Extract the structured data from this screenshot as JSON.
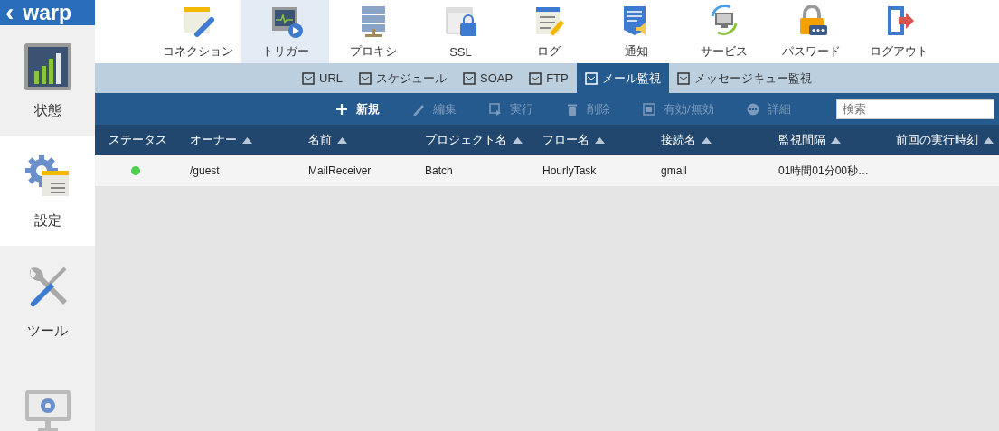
{
  "app": {
    "back_icon_glyph": "‹",
    "title": "warp"
  },
  "sidebar": {
    "items": [
      {
        "label": "状態",
        "selected": false
      },
      {
        "label": "設定",
        "selected": true
      },
      {
        "label": "ツール",
        "selected": false
      },
      {
        "selected": false
      }
    ]
  },
  "top_nav": {
    "items": [
      {
        "label": "コネクション",
        "selected": false
      },
      {
        "label": "トリガー",
        "selected": true
      },
      {
        "label": "プロキシ",
        "selected": false
      },
      {
        "label": "SSL",
        "selected": false
      },
      {
        "label": "ログ",
        "selected": false
      },
      {
        "label": "通知",
        "selected": false
      },
      {
        "label": "サービス",
        "selected": false
      },
      {
        "label": "パスワード",
        "selected": false
      },
      {
        "label": "ログアウト",
        "selected": false
      }
    ]
  },
  "sub_tabs": [
    {
      "label": "URL",
      "selected": false
    },
    {
      "label": "スケジュール",
      "selected": false
    },
    {
      "label": "SOAP",
      "selected": false
    },
    {
      "label": "FTP",
      "selected": false
    },
    {
      "label": "メール監視",
      "selected": true
    },
    {
      "label": "メッセージキュー監視",
      "selected": false
    }
  ],
  "toolbar": {
    "buttons": [
      {
        "label": "新規",
        "disabled": false
      },
      {
        "label": "編集",
        "disabled": true
      },
      {
        "label": "実行",
        "disabled": true
      },
      {
        "label": "削除",
        "disabled": true
      },
      {
        "label": "有効/無効",
        "disabled": true
      },
      {
        "label": "詳細",
        "disabled": true
      }
    ],
    "search": {
      "placeholder": "検索"
    }
  },
  "table": {
    "columns": [
      {
        "label": "ステータス",
        "sortable": false
      },
      {
        "label": "オーナー",
        "sortable": true
      },
      {
        "label": "名前",
        "sortable": true
      },
      {
        "label": "プロジェクト名",
        "sortable": true
      },
      {
        "label": "フロー名",
        "sortable": true
      },
      {
        "label": "接続名",
        "sortable": true
      },
      {
        "label": "監視間隔",
        "sortable": true
      },
      {
        "label": "前回の実行時刻",
        "sortable": true
      }
    ],
    "rows": [
      {
        "color": "#4cd04c",
        "cells": [
          "",
          "/guest",
          "MailReceiver",
          "Batch",
          "HourlyTask",
          "gmail",
          "01時間01分00秒…"
        ]
      }
    ]
  }
}
